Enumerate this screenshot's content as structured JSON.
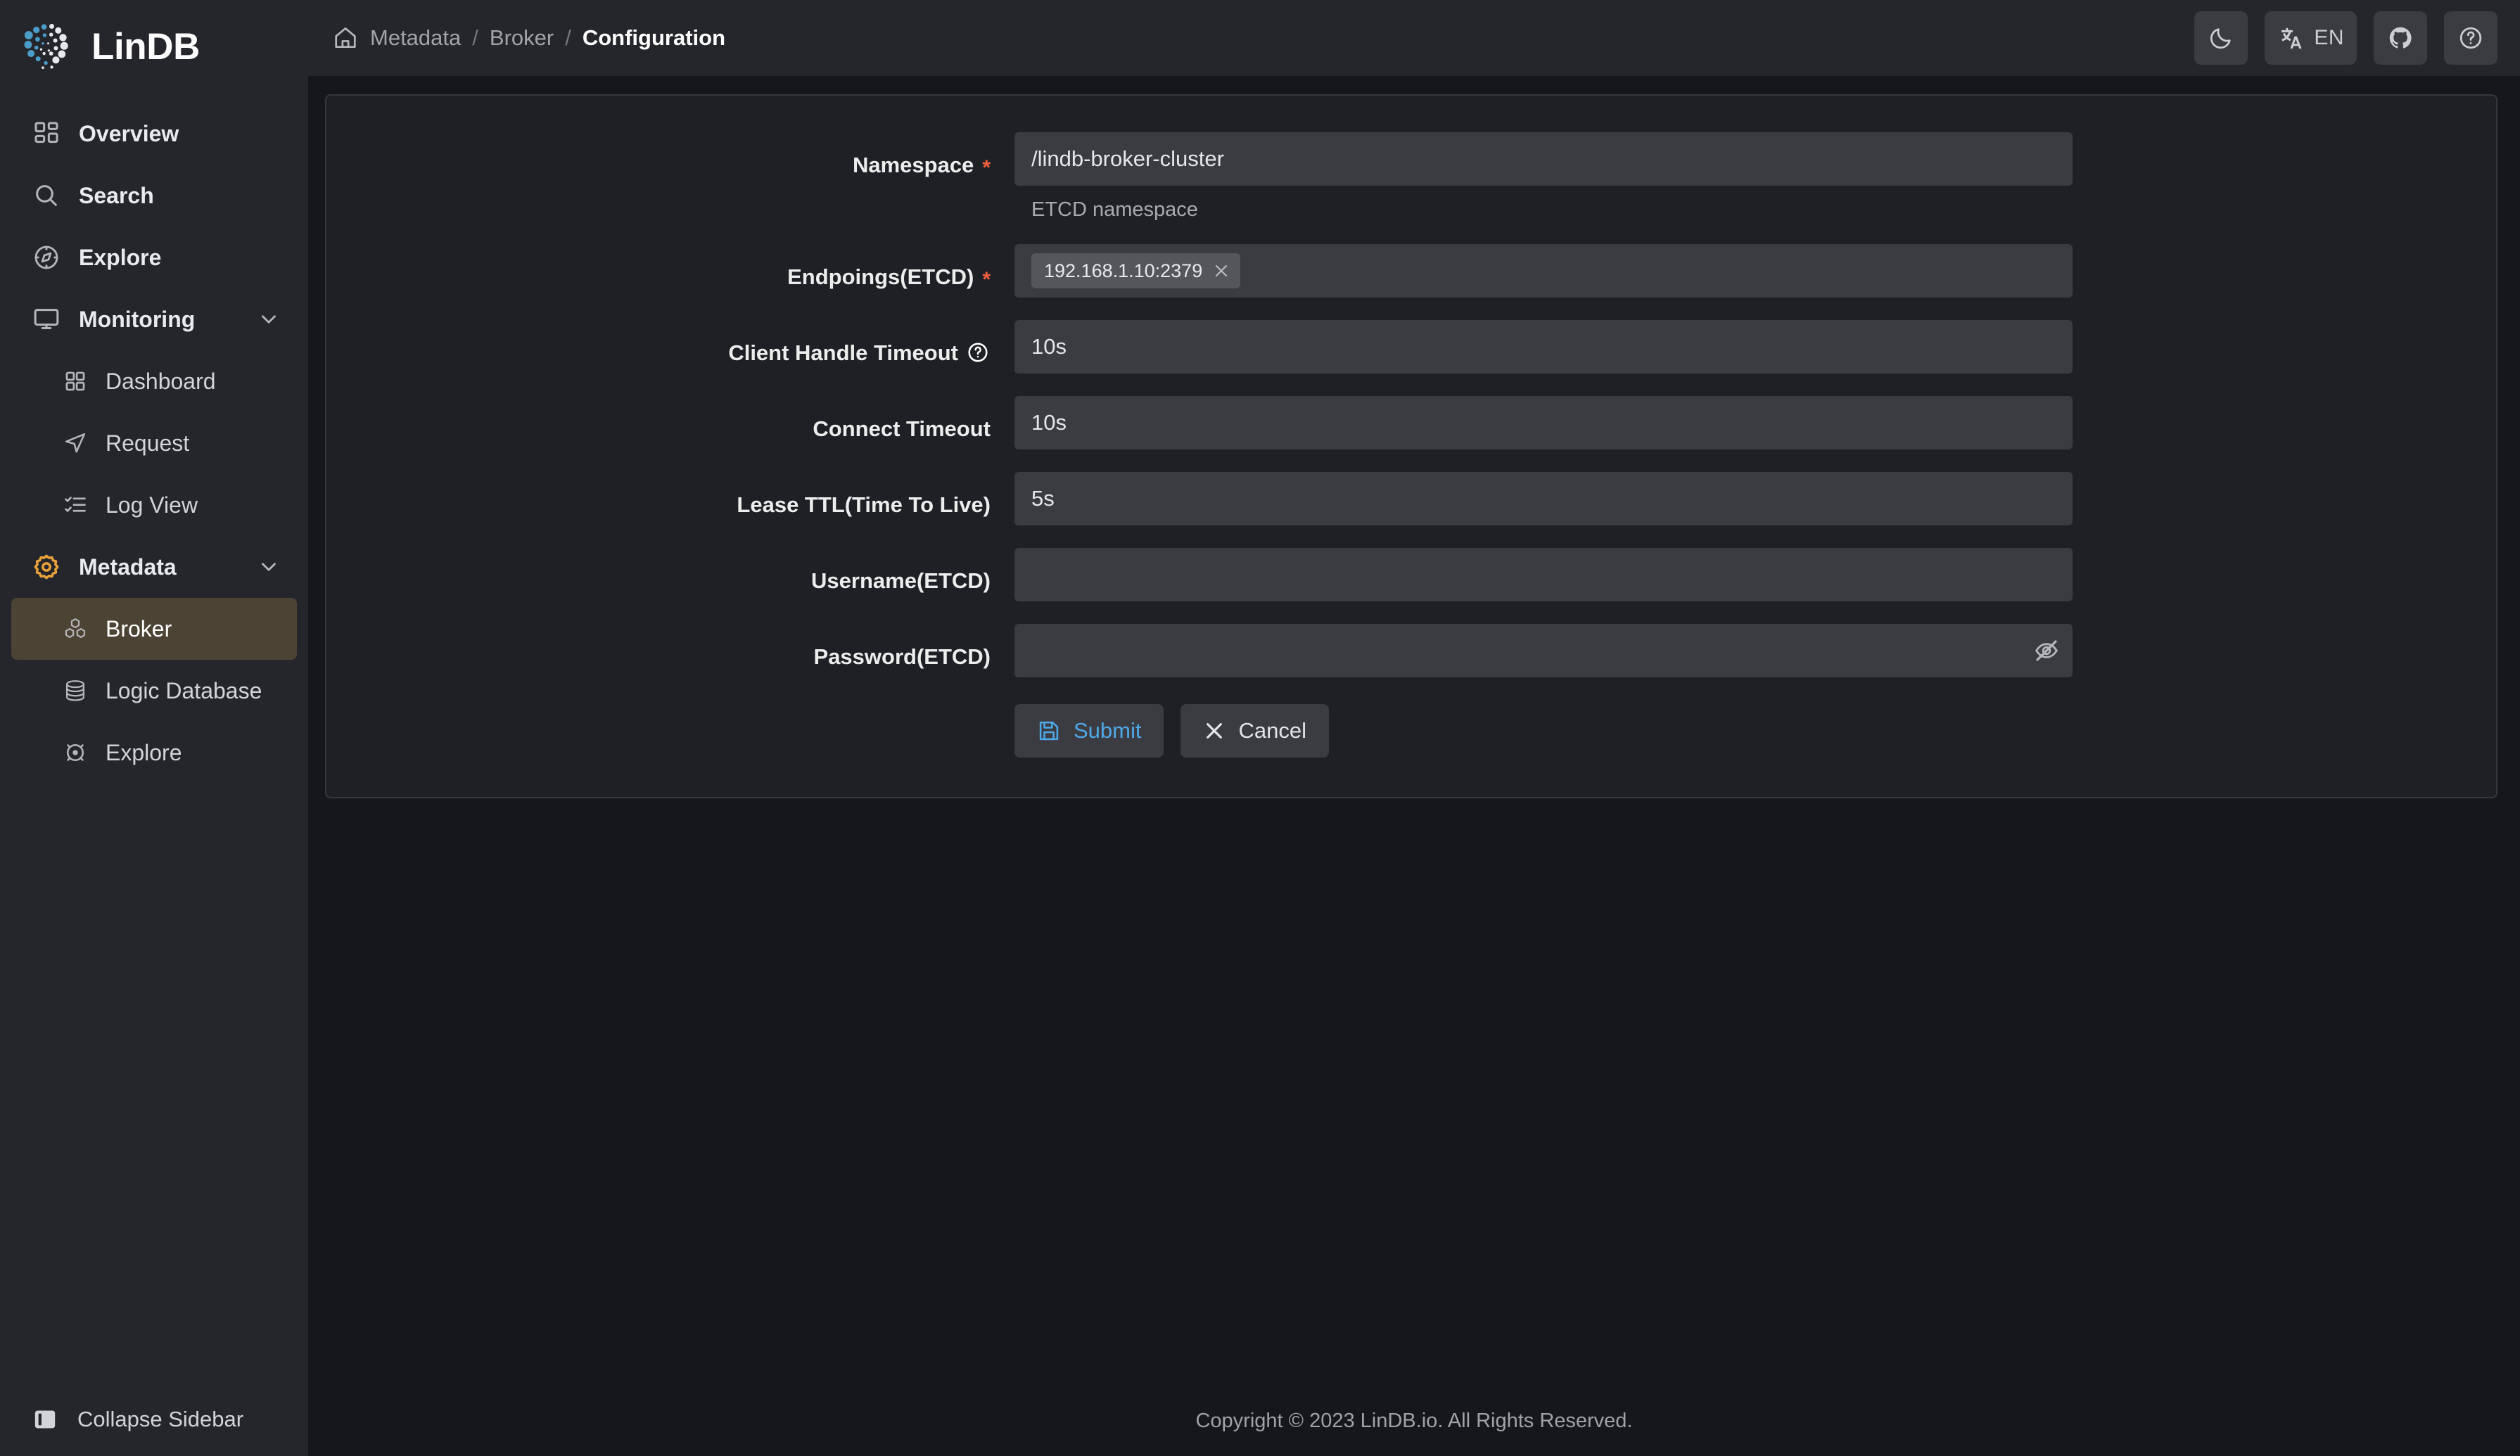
{
  "app": {
    "brand_name": "LinDB",
    "logo_icon": "lindb-dot-spiral-logo"
  },
  "sidebar": {
    "items": [
      {
        "label": "Overview",
        "icon": "layout-grid-icon",
        "level": "top",
        "active": false,
        "expandable": false
      },
      {
        "label": "Search",
        "icon": "search-icon",
        "level": "top",
        "active": false,
        "expandable": false
      },
      {
        "label": "Explore",
        "icon": "compass-icon",
        "level": "top",
        "active": false,
        "expandable": false
      },
      {
        "label": "Monitoring",
        "icon": "monitor-icon",
        "level": "top",
        "active": false,
        "expandable": true
      },
      {
        "label": "Dashboard",
        "icon": "grid-four-icon",
        "level": "sub",
        "active": false,
        "expandable": false
      },
      {
        "label": "Request",
        "icon": "send-plane-icon",
        "level": "sub",
        "active": false,
        "expandable": false
      },
      {
        "label": "Log View",
        "icon": "checklist-icon",
        "level": "sub",
        "active": false,
        "expandable": false
      },
      {
        "label": "Metadata",
        "icon": "gear-icon",
        "level": "top",
        "active": false,
        "expandable": true,
        "icon_color": "#e9a23b"
      },
      {
        "label": "Broker",
        "icon": "hexagon-cluster-icon",
        "level": "sub",
        "active": true,
        "expandable": false
      },
      {
        "label": "Logic Database",
        "icon": "database-icon",
        "level": "sub",
        "active": false,
        "expandable": false
      },
      {
        "label": "Explore",
        "icon": "target-circle-icon",
        "level": "sub",
        "active": false,
        "expandable": false
      }
    ],
    "collapse_label": "Collapse Sidebar",
    "collapse_icon": "sidebar-panel-icon",
    "active_bg": "#4d4335"
  },
  "topbar": {
    "home_icon": "home-icon",
    "breadcrumb": [
      {
        "label": "Metadata",
        "current": false
      },
      {
        "label": "Broker",
        "current": false
      },
      {
        "label": "Configuration",
        "current": true
      }
    ],
    "separator": "/",
    "actions": [
      {
        "name": "theme-toggle-button",
        "icon": "moon-icon",
        "text": ""
      },
      {
        "name": "language-button",
        "icon": "translate-icon",
        "text": "EN"
      },
      {
        "name": "github-link-button",
        "icon": "github-icon",
        "text": ""
      },
      {
        "name": "help-button",
        "icon": "question-circle-icon",
        "text": ""
      }
    ]
  },
  "form": {
    "fields": [
      {
        "label": "Namespace",
        "required": true,
        "help_icon": false,
        "type": "text",
        "value": "/lindb-broker-cluster",
        "placeholder": "",
        "description": "ETCD namespace"
      },
      {
        "label": "Endpoings(ETCD)",
        "required": true,
        "help_icon": false,
        "type": "tags",
        "tags": [
          "192.168.1.10:2379"
        ],
        "tag_close_icon": "close-icon",
        "placeholder": "",
        "description": ""
      },
      {
        "label": "Client Handle Timeout",
        "required": false,
        "help_icon": true,
        "type": "text",
        "value": "10s",
        "placeholder": "",
        "description": ""
      },
      {
        "label": "Connect Timeout",
        "required": false,
        "help_icon": false,
        "type": "text",
        "value": "10s",
        "placeholder": "",
        "description": ""
      },
      {
        "label": "Lease TTL(Time To Live)",
        "required": false,
        "help_icon": false,
        "type": "text",
        "value": "5s",
        "placeholder": "",
        "description": ""
      },
      {
        "label": "Username(ETCD)",
        "required": false,
        "help_icon": false,
        "type": "text",
        "value": "",
        "placeholder": "",
        "description": ""
      },
      {
        "label": "Password(ETCD)",
        "required": false,
        "help_icon": false,
        "type": "password",
        "value": "",
        "placeholder": "",
        "description": "",
        "suffix_icon": "eye-off-icon"
      }
    ],
    "submit_label": "Submit",
    "submit_icon": "save-icon",
    "submit_color": "#4fa8e8",
    "cancel_label": "Cancel",
    "cancel_icon": "close-icon"
  },
  "footer": {
    "copyright": "Copyright © 2023 LinDB.io. All Rights Reserved."
  }
}
